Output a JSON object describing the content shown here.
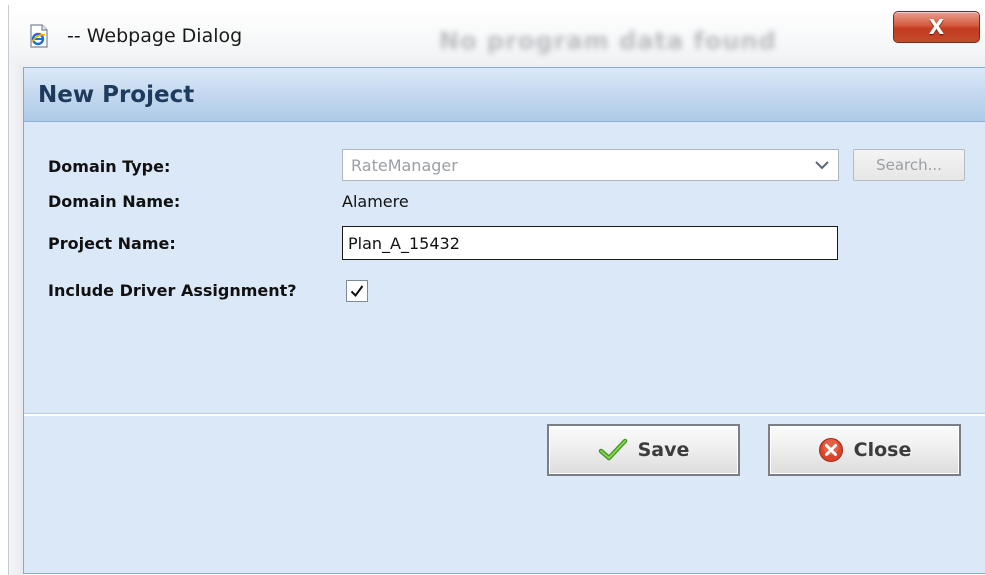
{
  "window": {
    "title": "-- Webpage Dialog",
    "background_text": "No program data found",
    "close_label": "X"
  },
  "dialog": {
    "title": "New Project",
    "fields": {
      "domain_type_label": "Domain Type:",
      "domain_type_value": "RateManager",
      "search_label": "Search...",
      "domain_name_label": "Domain Name:",
      "domain_name_value": "Alamere",
      "project_name_label": "Project Name:",
      "project_name_value": "Plan_A_15432",
      "include_driver_label": "Include Driver Assignment?",
      "include_driver_checked": true
    },
    "buttons": {
      "save_label": "Save",
      "close_label": "Close"
    }
  },
  "colors": {
    "dialog_bg": "#dbe8f8",
    "header_text": "#1e3a5c",
    "save_check": "#4caf2a",
    "close_icon": "#d9442a"
  },
  "icons": {
    "title_icon": "ie-document-icon",
    "save_icon": "checkmark-icon",
    "close_icon": "close-circle-icon",
    "dropdown_icon": "chevron-down-icon"
  }
}
